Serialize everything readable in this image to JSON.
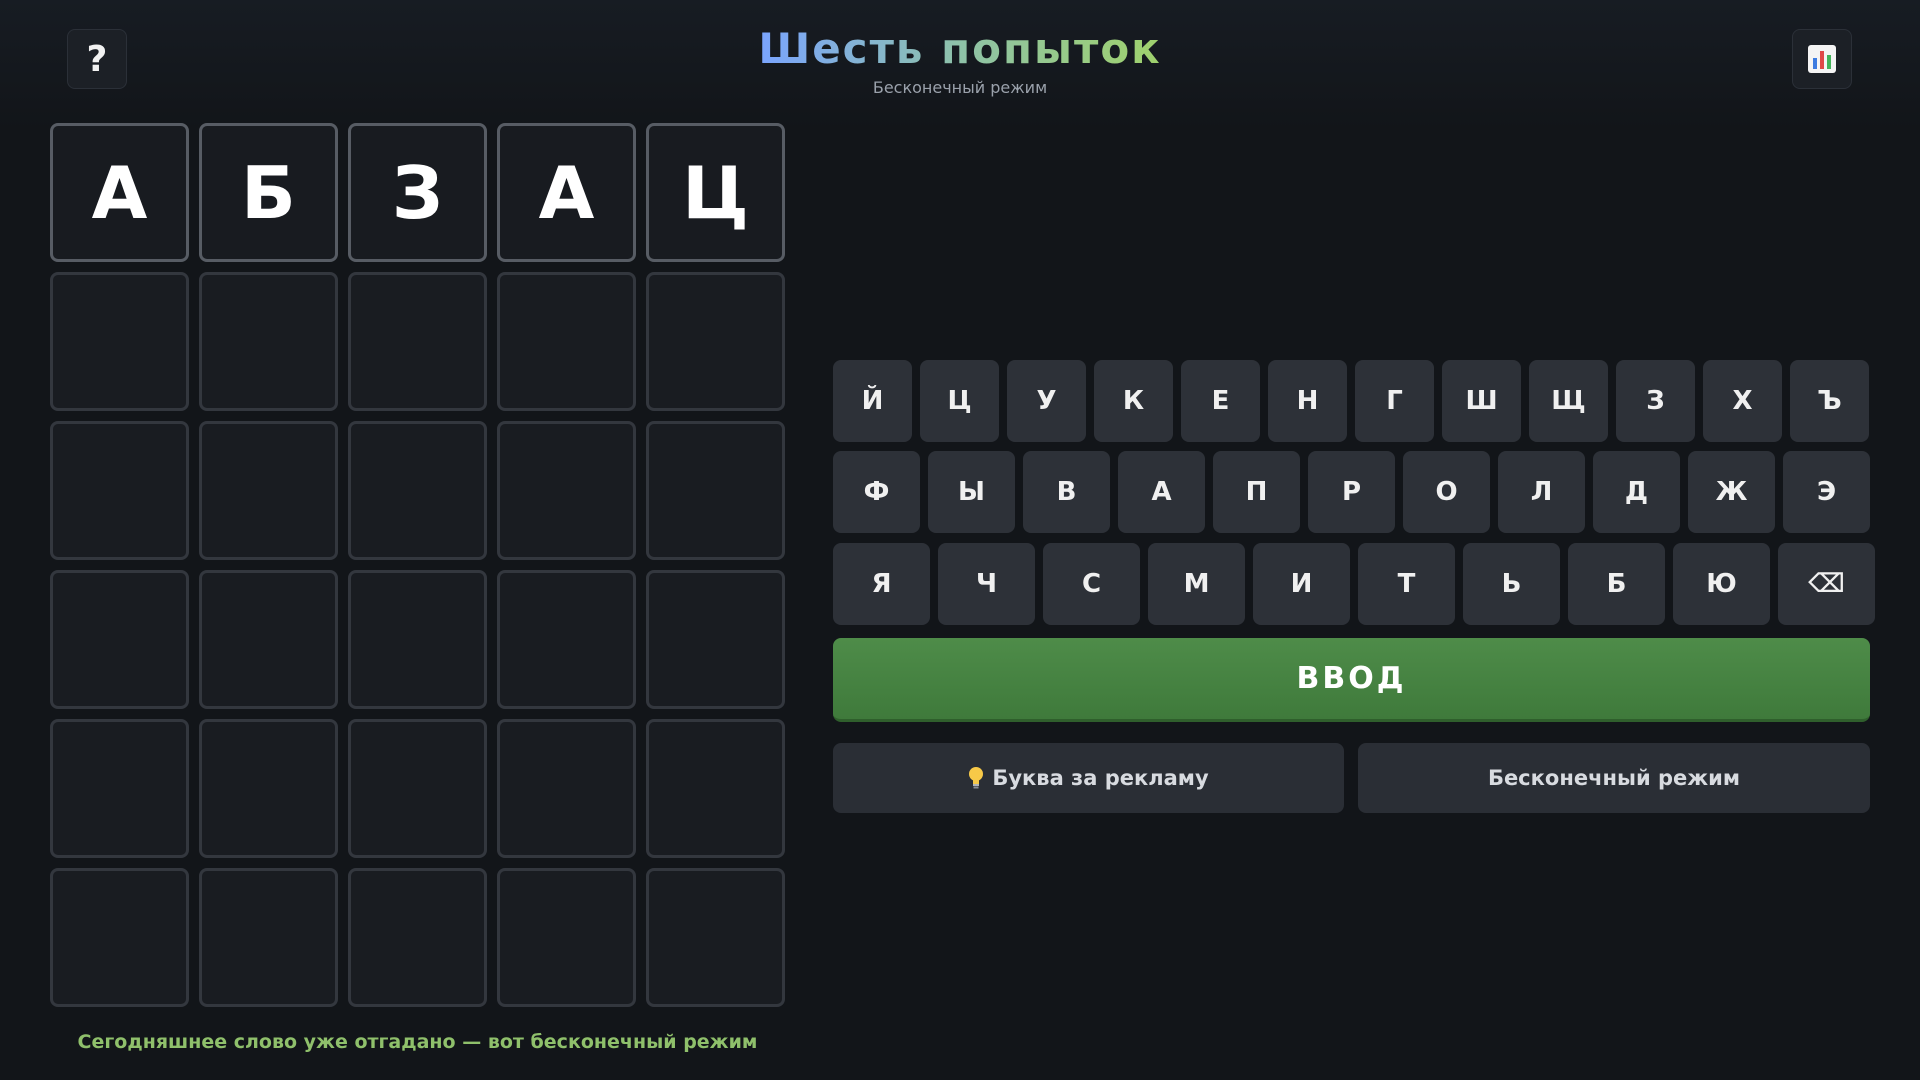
{
  "header": {
    "title": "Шесть попыток",
    "subtitle": "Бесконечный режим",
    "help_icon": "question-mark-icon",
    "stats_icon": "bar-chart-icon"
  },
  "board": {
    "rows": [
      [
        "А",
        "Б",
        "З",
        "А",
        "Ц"
      ],
      [
        "",
        "",
        "",
        "",
        ""
      ],
      [
        "",
        "",
        "",
        "",
        ""
      ],
      [
        "",
        "",
        "",
        "",
        ""
      ],
      [
        "",
        "",
        "",
        "",
        ""
      ],
      [
        "",
        "",
        "",
        "",
        ""
      ]
    ]
  },
  "keyboard": {
    "row1": [
      "Й",
      "Ц",
      "У",
      "К",
      "Е",
      "Н",
      "Г",
      "Ш",
      "Щ",
      "З",
      "Х",
      "Ъ"
    ],
    "row2": [
      "Ф",
      "Ы",
      "В",
      "А",
      "П",
      "Р",
      "О",
      "Л",
      "Д",
      "Ж",
      "Э"
    ],
    "row3": [
      "Я",
      "Ч",
      "С",
      "М",
      "И",
      "Т",
      "Ь",
      "Б",
      "Ю",
      "⌫"
    ],
    "enter_label": "ВВОД",
    "backspace_icon": "backspace-icon"
  },
  "actions": {
    "hint_label": "Буква за рекламу",
    "hint_icon": "lightbulb-icon",
    "endless_label": "Бесконечный режим"
  },
  "footer": {
    "message": "Сегодняшнее слово уже отгадано — вот бесконечный режим"
  },
  "colors": {
    "background": "#121519",
    "tile_border": "#33373e",
    "tile_filled_border": "#575c64",
    "key_bg": "#2d3138",
    "enter_bg": "#4a8746",
    "footer_text": "#8fc06b",
    "title_gradient_start": "#7aa4ff",
    "title_gradient_end": "#9fd16c"
  }
}
